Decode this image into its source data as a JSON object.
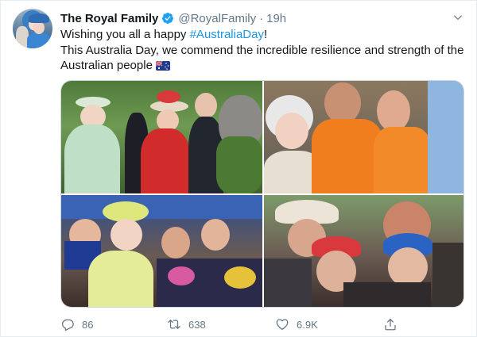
{
  "tweet": {
    "author_name": "The Royal Family",
    "handle": "@RoyalFamily",
    "separator": "·",
    "time": "19h",
    "line1_prefix": "Wishing you all a happy ",
    "hashtag": "#AustraliaDay",
    "line1_suffix": "!",
    "body": "This Australia Day, we commend the incredible resilience and strength of the Australian people"
  },
  "icons": {
    "verified": "verified-badge-icon",
    "caret": "chevron-down-icon",
    "flag": "australia-flag-emoji",
    "reply": "reply-icon",
    "retweet": "retweet-icon",
    "like": "heart-icon",
    "share": "share-icon"
  },
  "actions": {
    "reply_count": "86",
    "retweet_count": "638",
    "like_count": "6.9K"
  },
  "colors": {
    "link": "#1b95e0",
    "secondary_text": "#657786",
    "primary_text": "#14171a",
    "verified": "#1da1f2",
    "border": "#e6ecf0"
  }
}
